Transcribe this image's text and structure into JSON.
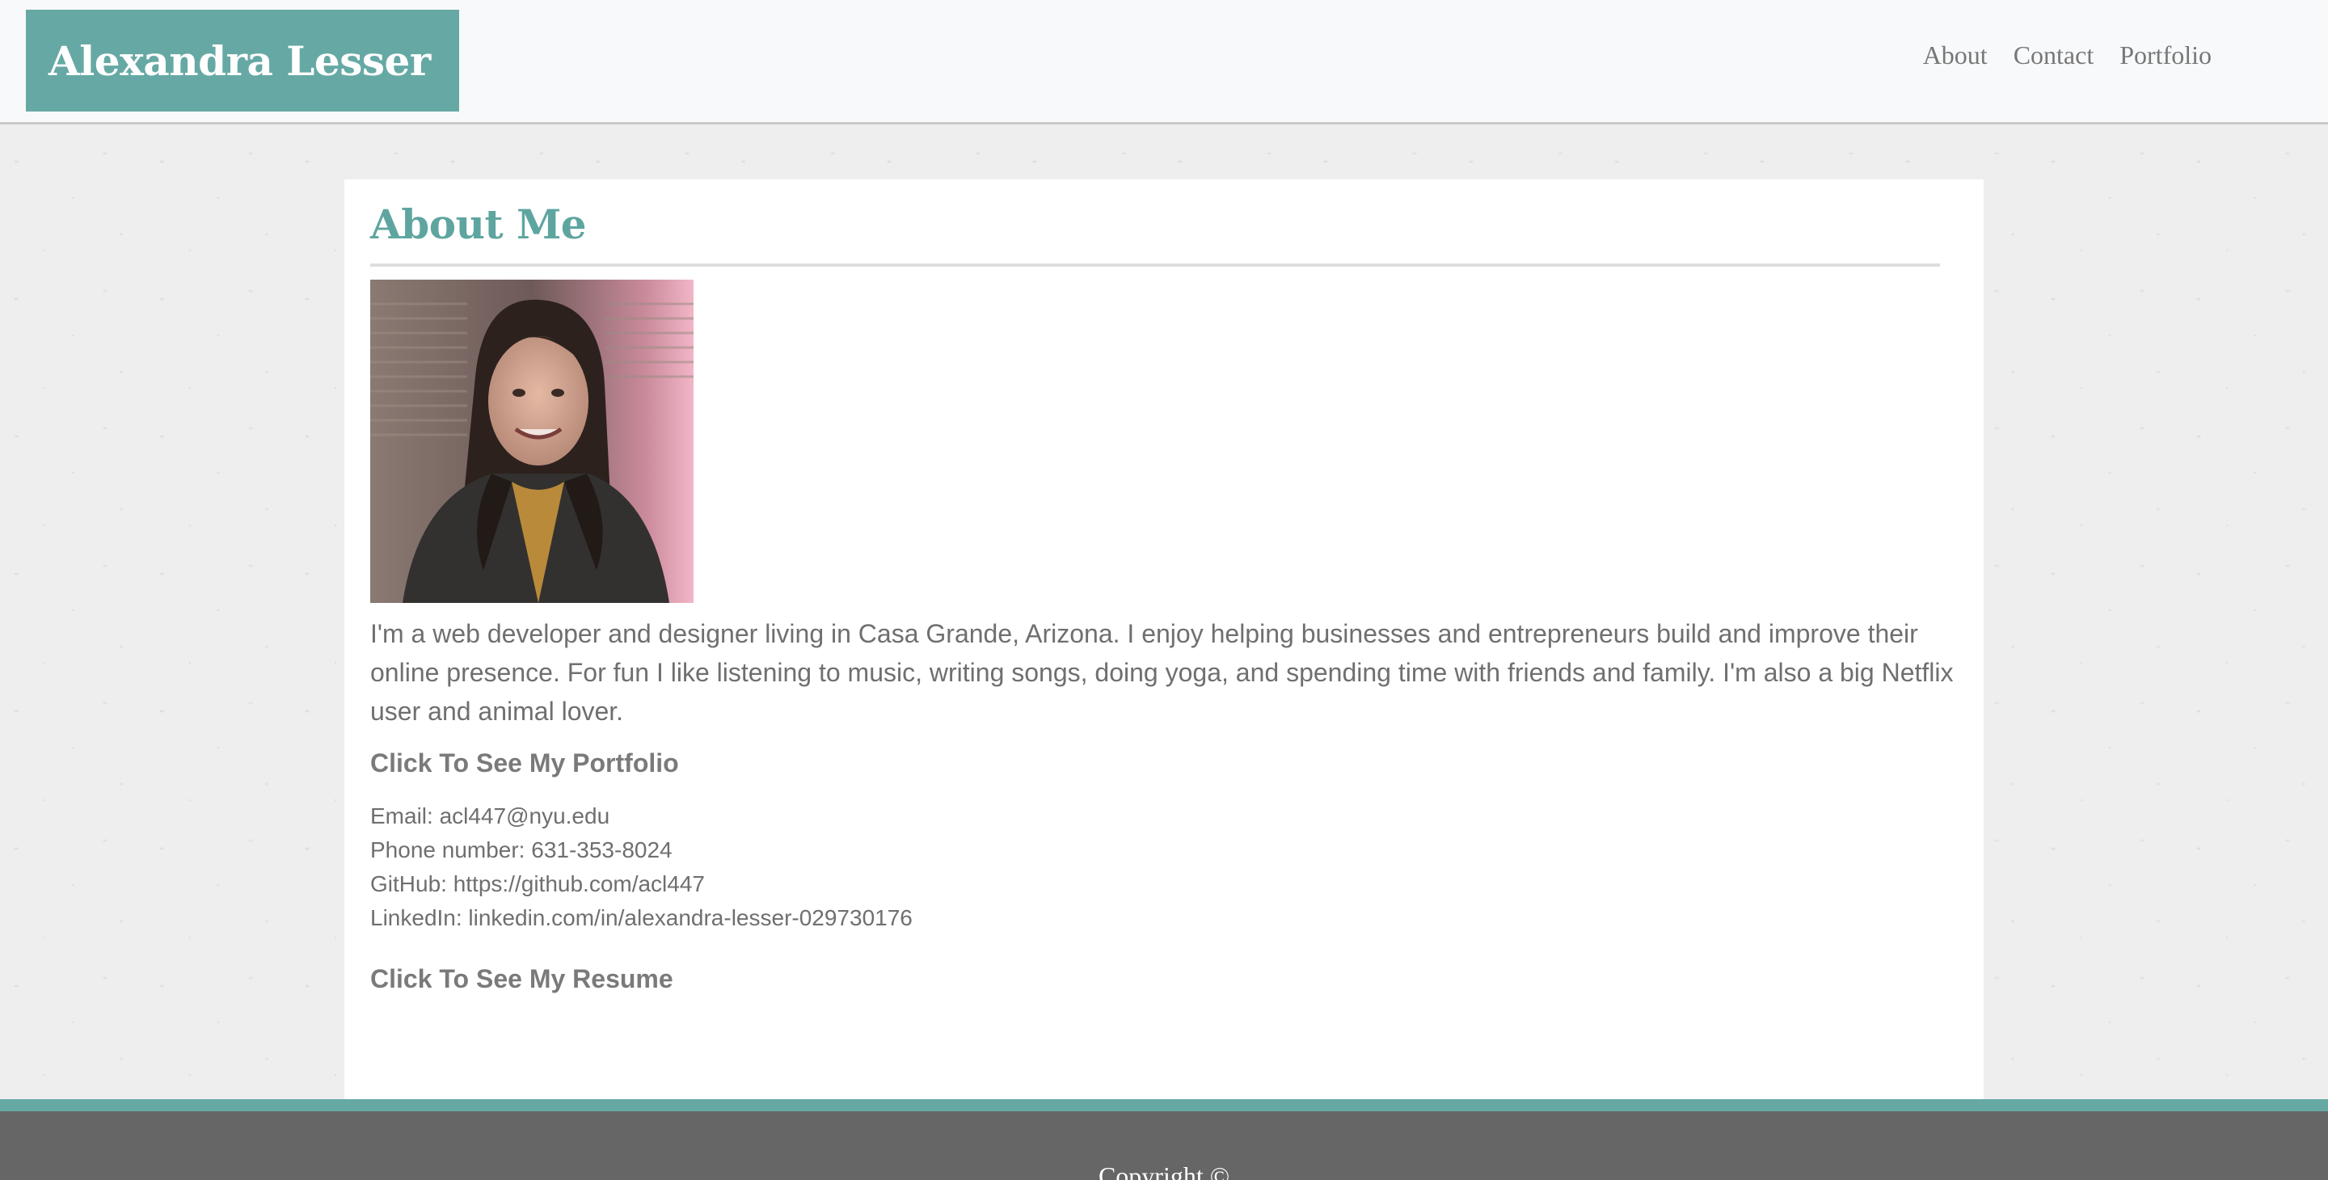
{
  "header": {
    "brand": "Alexandra Lesser",
    "nav": [
      {
        "label": "About"
      },
      {
        "label": "Contact"
      },
      {
        "label": "Portfolio"
      }
    ]
  },
  "main": {
    "title": "About Me",
    "bio": "I'm a web developer and designer living in Casa Grande, Arizona. I enjoy helping businesses and entrepreneurs build and improve their online presence. For fun I like listening to music, writing songs, doing yoga, and spending time with friends and family. I'm also a big Netflix user and animal lover.",
    "portfolio_link": "Click To See My Portfolio",
    "contact": {
      "email": "Email: acl447@nyu.edu",
      "phone": "Phone number: 631-353-8024",
      "github": "GitHub: https://github.com/acl447",
      "linkedin": "LinkedIn: linkedin.com/in/alexandra-lesser-029730176"
    },
    "resume_link": "Click To See My Resume"
  },
  "footer": {
    "copyright": "Copyright ©"
  },
  "colors": {
    "accent": "#66a9a4",
    "title": "#5ea5a0",
    "text": "#6f6f6f",
    "footer": "#666666"
  }
}
